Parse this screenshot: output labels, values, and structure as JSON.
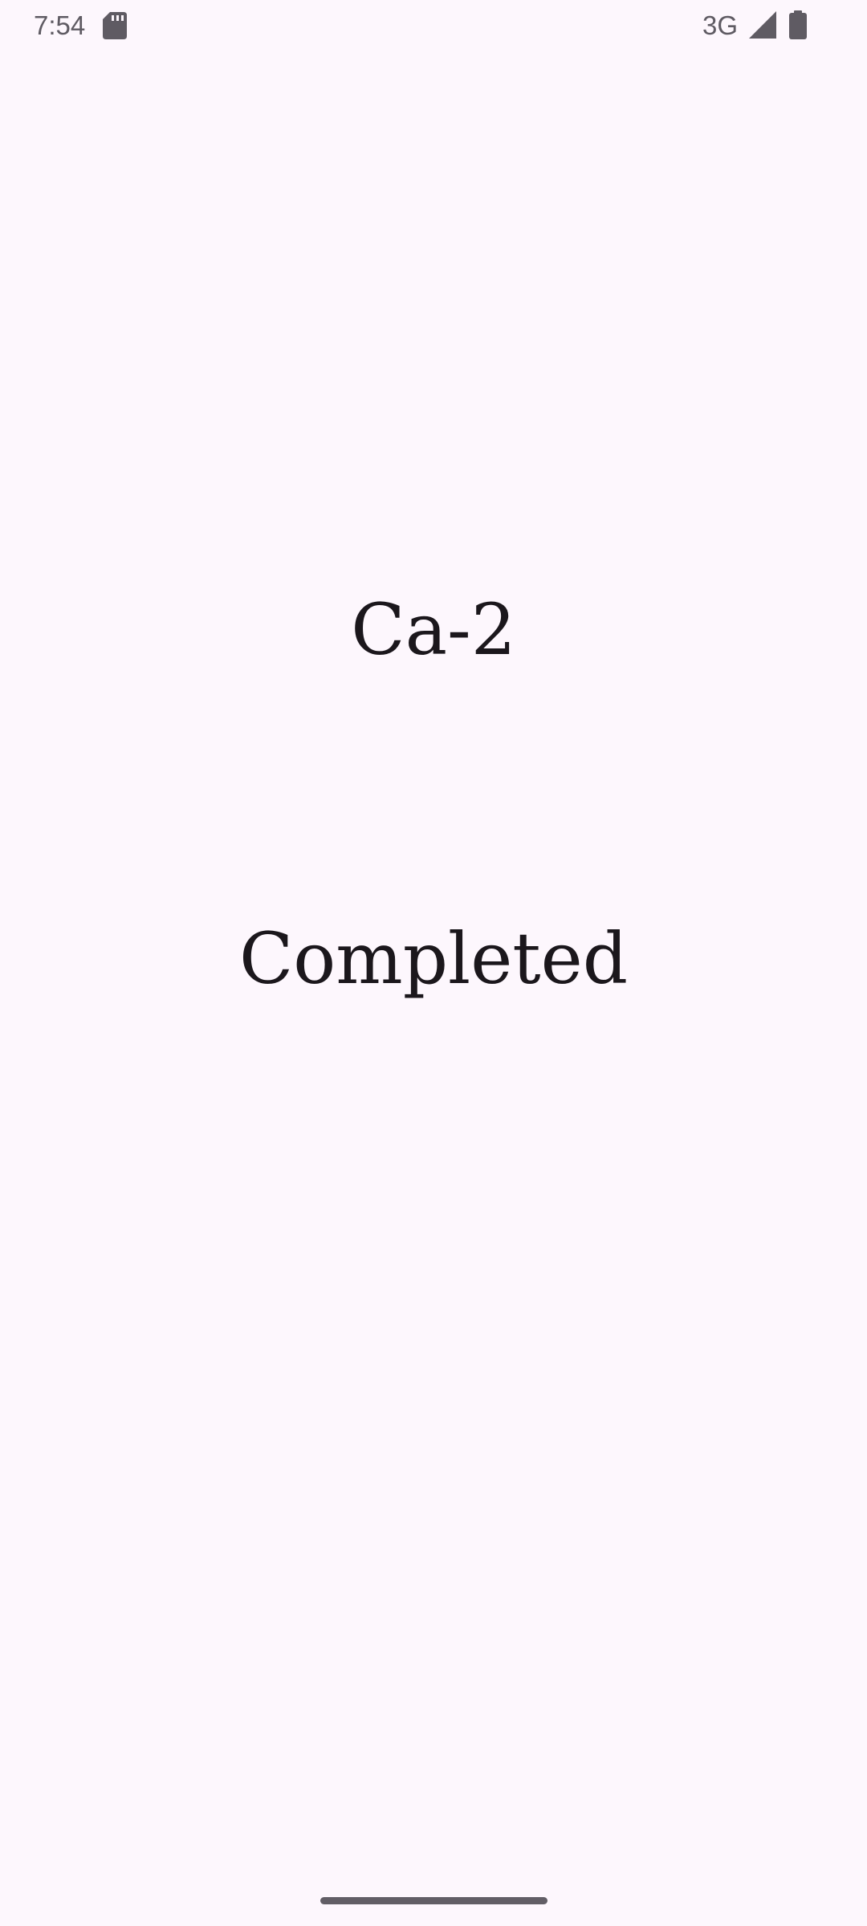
{
  "status_bar": {
    "time": "7:54",
    "network": "3G",
    "icons": [
      "sd-card-icon",
      "cell-signal-icon",
      "battery-icon"
    ]
  },
  "main": {
    "title": "Ca-2",
    "message": "Completed"
  },
  "colors": {
    "background": "#fdf7fd",
    "text": "#1b171c",
    "status_icons": "#5f5b63",
    "gesture_handle": "#625e66"
  }
}
